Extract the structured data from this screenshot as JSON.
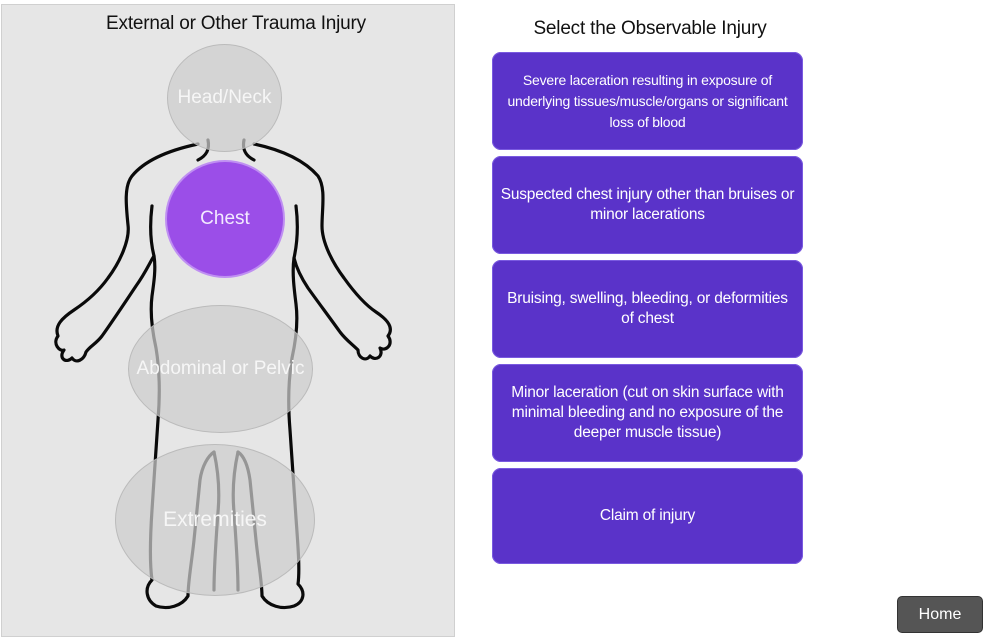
{
  "body_map": {
    "title": "External or Other Trauma Injury",
    "regions": {
      "head_neck": "Head/Neck",
      "chest": "Chest",
      "abdominal_pelvic": "Abdominal or Pelvic",
      "extremities": "Extremities"
    },
    "selected_region": "Chest"
  },
  "injury_options": {
    "title": "Select the Observable Injury",
    "items": [
      {
        "label": "Severe laceration resulting in exposure of underlying tissues/muscle/organs or significant loss of blood"
      },
      {
        "label": "Suspected chest injury other than bruises or minor lacerations"
      },
      {
        "label": "Bruising, swelling, bleeding, or deformities of chest"
      },
      {
        "label": "Minor laceration (cut on skin surface with minimal bleeding and no exposure of the deeper muscle tissue)"
      },
      {
        "label": "Claim of injury"
      }
    ]
  },
  "nav": {
    "home_label": "Home"
  },
  "colors": {
    "option_button": "#5a33c9",
    "selected_region": "#9b4ee8",
    "panel_background": "#e6e6e6",
    "home_button": "#555555"
  }
}
